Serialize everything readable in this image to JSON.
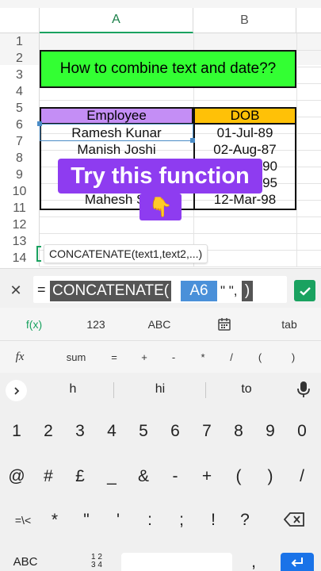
{
  "sheet": {
    "col_headers": [
      "A",
      "B"
    ],
    "row_numbers": [
      "1",
      "2",
      "3",
      "4",
      "5",
      "6",
      "7",
      "8",
      "9",
      "10",
      "11",
      "12",
      "13",
      "14"
    ],
    "title": "How to combine text and date??",
    "headers": {
      "employee": "Employee",
      "dob": "DOB"
    },
    "rows": [
      {
        "employee": "Ramesh Kunar",
        "dob": "01-Jul-89"
      },
      {
        "employee": "Manish Joshi",
        "dob": "02-Aug-87"
      },
      {
        "employee": "",
        "dob": "90"
      },
      {
        "employee": "",
        "dob": "95"
      },
      {
        "employee": "Mahesh Si",
        "dob": "12-Mar-98"
      }
    ],
    "tooltip": "CONCATENATE(text1,text2,...)"
  },
  "overlay": {
    "text": "Try this function",
    "hand": "👇"
  },
  "formula_bar": {
    "cancel": "✕",
    "equals": "=",
    "fn": "CONCATENATE(",
    "ref": "A6",
    "rest": "\" \",",
    "paren": ")"
  },
  "toolbar1": [
    "f(x)",
    "123",
    "ABC",
    "calendar-icon",
    "tab"
  ],
  "toolbar2": [
    "fx",
    "sum",
    "=",
    "+",
    "-",
    "*",
    "/",
    "(",
    ")"
  ],
  "suggestions": [
    "h",
    "hi",
    "to"
  ],
  "keys": {
    "row1": [
      "1",
      "2",
      "3",
      "4",
      "5",
      "6",
      "7",
      "8",
      "9",
      "0"
    ],
    "row2": [
      "@",
      "#",
      "£",
      "_",
      "&",
      "-",
      "+",
      "(",
      ")",
      "/"
    ],
    "row3": [
      "=\\<",
      "*",
      "\"",
      "'",
      ":",
      ";",
      "!",
      "?"
    ],
    "abc": "ABC",
    "numpad": "1 2\n3 4",
    "comma": ","
  },
  "colors": {
    "green": "#1aa260",
    "purple": "#8e3cf0",
    "title_bg": "#33ff33",
    "emp_bg": "#c48ef5",
    "dob_bg": "#ffc107",
    "blue": "#1a73e8"
  }
}
